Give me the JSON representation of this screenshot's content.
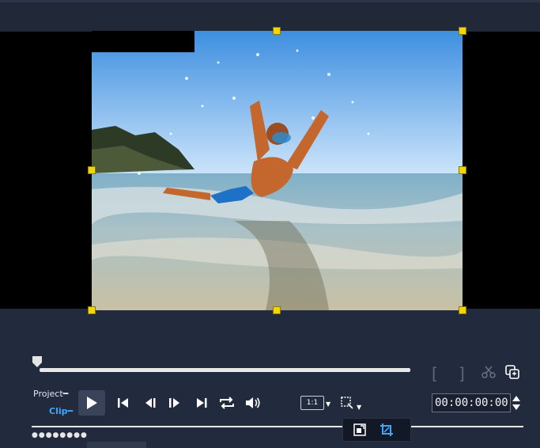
{
  "playback": {
    "mode_project_label": "Project",
    "mode_clip_label": "Clip",
    "timecode": "00:00:00:00",
    "aspect_ratio_label": "1:1",
    "scrubber_position": 0.0
  },
  "icons": {
    "mark_in": "bracket-left-icon",
    "mark_out": "bracket-right-icon",
    "split": "scissors-icon",
    "copy": "copy-icon",
    "play": "play-icon",
    "prev": "skip-back-icon",
    "frame_back": "frame-back-icon",
    "frame_fwd": "frame-forward-icon",
    "next": "skip-forward-icon",
    "repeat": "repeat-icon",
    "volume": "volume-icon",
    "zoom_dropdown": "resize-dropdown-icon",
    "crop_fit": "fit-to-screen-icon",
    "crop": "crop-icon"
  },
  "colors": {
    "accent_clip": "#3ea8ff",
    "handle": "#f2d600",
    "panel_bg": "#222a3d",
    "preview_bg": "#000000"
  }
}
